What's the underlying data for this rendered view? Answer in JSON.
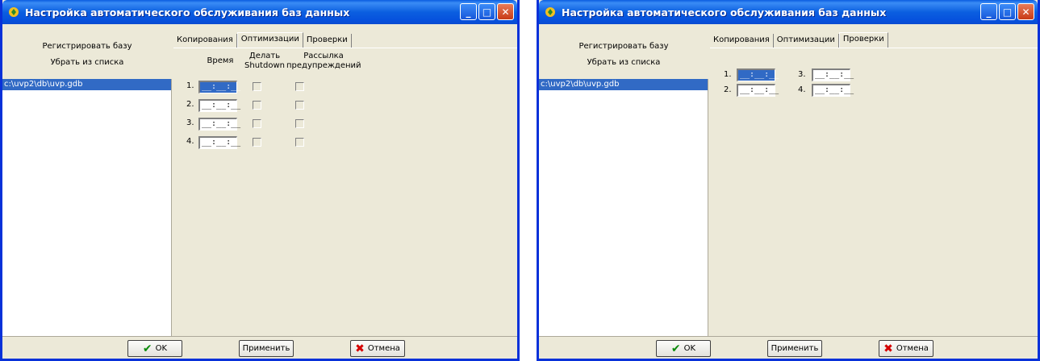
{
  "windows": [
    {
      "title": "Настройка автоматического обслуживания баз данных",
      "register_button": "Регистрировать базу",
      "remove_button": "Убрать из списка",
      "db_items": [
        "c:\\uvp2\\db\\uvp.gdb"
      ],
      "tabs": [
        "Копирования",
        "Оптимизации",
        "Проверки"
      ],
      "active_tab": "Оптимизации",
      "optim": {
        "col_time": "Время",
        "col_shutdown": "Делать\nShutdown",
        "col_warn": "Рассылка\nпредупреждений",
        "rows": [
          {
            "label": "1.",
            "value": "__:__:__",
            "selected": true
          },
          {
            "label": "2.",
            "value": "__:__:__",
            "selected": false
          },
          {
            "label": "3.",
            "value": "__:__:__",
            "selected": false
          },
          {
            "label": "4.",
            "value": "__:__:__",
            "selected": false
          }
        ]
      },
      "ok": "OK",
      "apply": "Применить",
      "cancel": "Отмена"
    },
    {
      "title": "Настройка автоматического обслуживания баз данных",
      "register_button": "Регистрировать базу",
      "remove_button": "Убрать из списка",
      "db_items": [
        "c:\\uvp2\\db\\uvp.gdb"
      ],
      "tabs": [
        "Копирования",
        "Оптимизации",
        "Проверки"
      ],
      "active_tab": "Проверки",
      "check": {
        "rows": [
          {
            "label": "1.",
            "value": "__:__:__",
            "selected": true
          },
          {
            "label": "2.",
            "value": "__:__:__",
            "selected": false
          },
          {
            "label": "3.",
            "value": "__:__:__",
            "selected": false
          },
          {
            "label": "4.",
            "value": "__:__:__",
            "selected": false
          }
        ]
      },
      "ok": "OK",
      "apply": "Применить",
      "cancel": "Отмена"
    }
  ],
  "colors": {
    "titlebar": "#0b5fe0",
    "selection": "#316ac5",
    "window_bg": "#ece9d8"
  }
}
